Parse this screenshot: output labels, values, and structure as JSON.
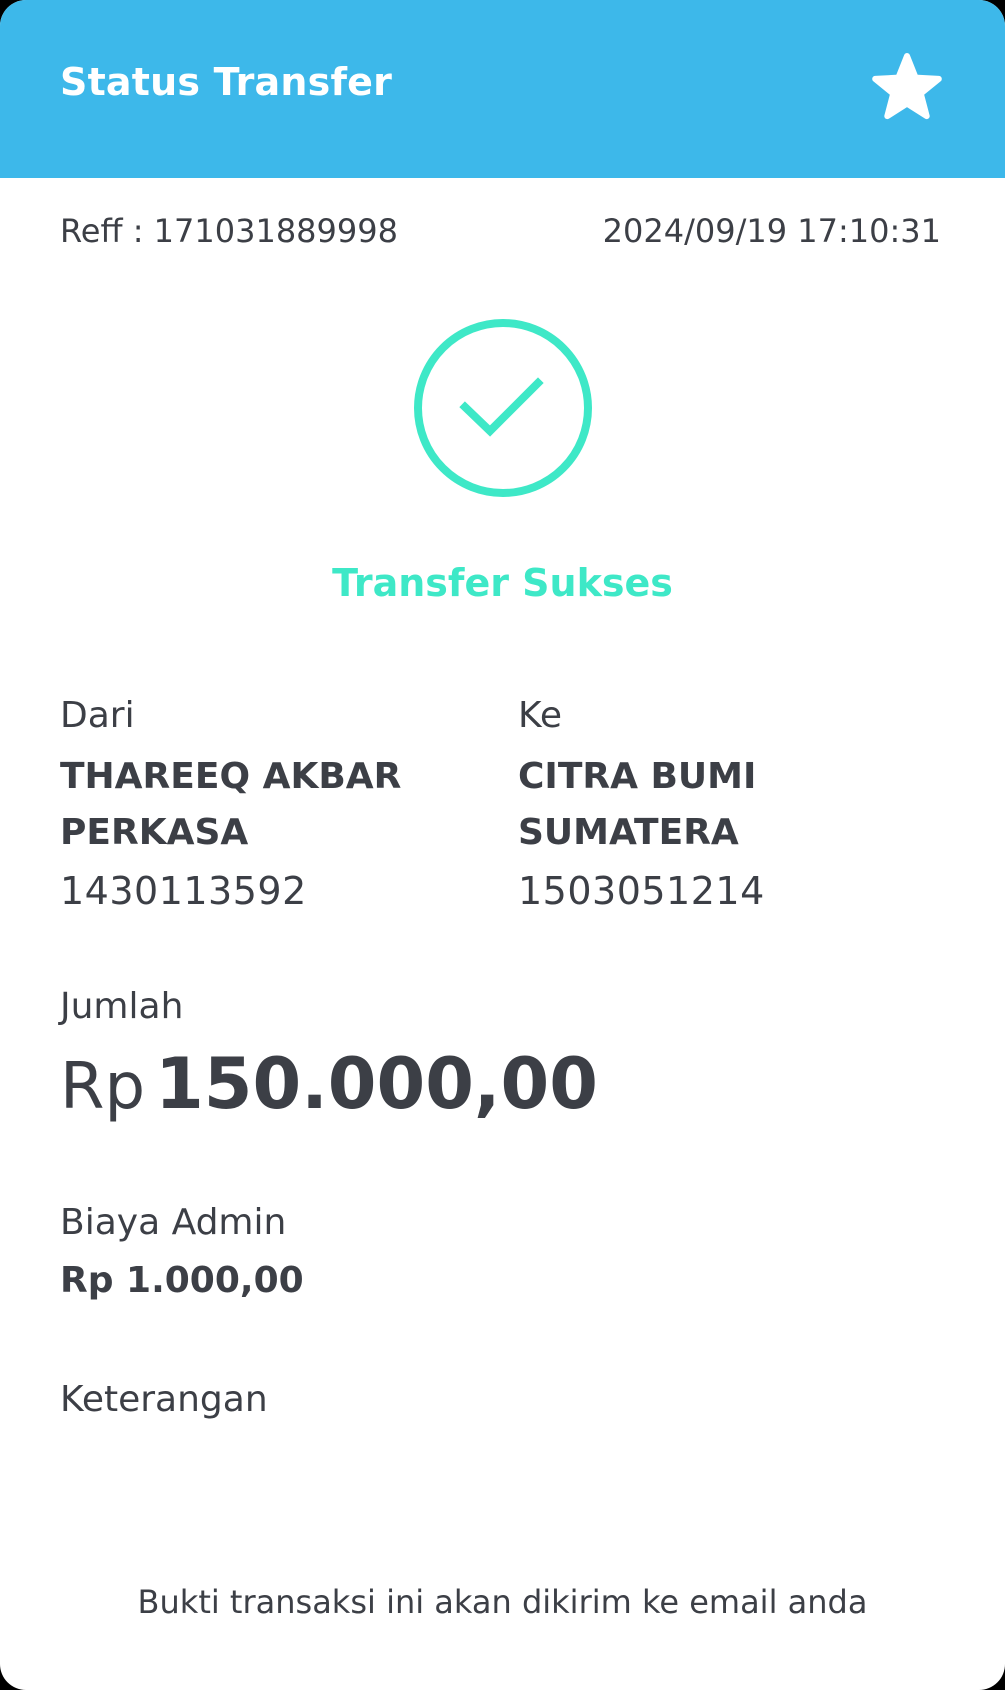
{
  "header": {
    "title": "Status Transfer",
    "favorite_icon": "star-icon",
    "background_color": "#3db8ea"
  },
  "meta": {
    "reference": "Reff : 171031889998",
    "datetime": "2024/09/19 17:10:31"
  },
  "status": {
    "icon": "check-circle-icon",
    "text": "Transfer Sukses",
    "color": "#3ee8c7"
  },
  "from": {
    "label": "Dari",
    "name": "THAREEQ AKBAR PERKASA",
    "account": "1430113592"
  },
  "to": {
    "label": "Ke",
    "name": "CITRA BUMI SUMATERA",
    "account": "1503051214"
  },
  "amount": {
    "label": "Jumlah",
    "currency": "Rp",
    "value": "150.000,00"
  },
  "fee": {
    "label": "Biaya Admin",
    "value": "Rp 1.000,00"
  },
  "note": {
    "label": "Keterangan"
  },
  "footer": {
    "text": "Bukti transaksi ini akan dikirim ke email anda"
  }
}
